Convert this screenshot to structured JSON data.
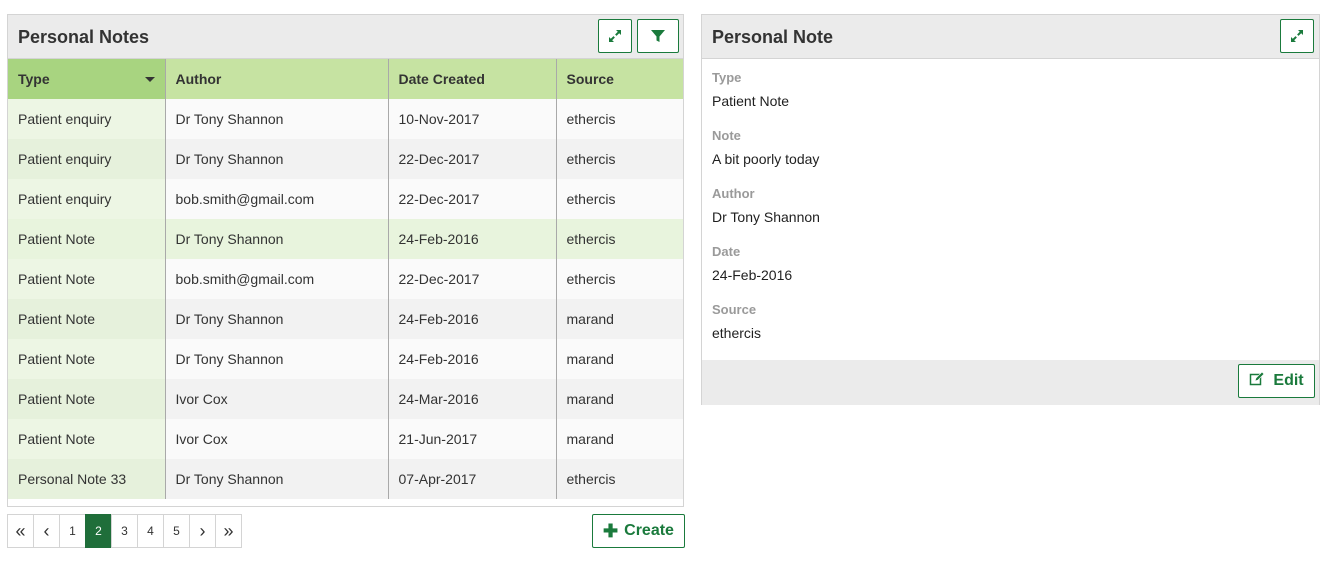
{
  "left_panel": {
    "title": "Personal Notes",
    "expand_icon": "expand-icon",
    "filter_icon": "filter-icon",
    "columns": [
      "Type",
      "Author",
      "Date Created",
      "Source"
    ],
    "sorted_column": "Type",
    "rows": [
      [
        "Patient enquiry",
        "Dr Tony Shannon",
        "10-Nov-2017",
        "ethercis"
      ],
      [
        "Patient enquiry",
        "Dr Tony Shannon",
        "22-Dec-2017",
        "ethercis"
      ],
      [
        "Patient enquiry",
        "bob.smith@gmail.com",
        "22-Dec-2017",
        "ethercis"
      ],
      [
        "Patient Note",
        "Dr Tony Shannon",
        "24-Feb-2016",
        "ethercis"
      ],
      [
        "Patient Note",
        "bob.smith@gmail.com",
        "22-Dec-2017",
        "ethercis"
      ],
      [
        "Patient Note",
        "Dr Tony Shannon",
        "24-Feb-2016",
        "marand"
      ],
      [
        "Patient Note",
        "Dr Tony Shannon",
        "24-Feb-2016",
        "marand"
      ],
      [
        "Patient Note",
        "Ivor Cox",
        "24-Mar-2016",
        "marand"
      ],
      [
        "Patient Note",
        "Ivor Cox",
        "21-Jun-2017",
        "marand"
      ],
      [
        "Personal Note 33",
        "Dr Tony Shannon",
        "07-Apr-2017",
        "ethercis"
      ]
    ],
    "selected_row": 3
  },
  "pagination": {
    "first": "«",
    "prev": "‹",
    "pages": [
      "1",
      "2",
      "3",
      "4",
      "5"
    ],
    "current": "2",
    "next": "›",
    "last": "»"
  },
  "create_button": {
    "label": "Create",
    "icon": "plus-icon"
  },
  "right_panel": {
    "title": "Personal Note",
    "expand_icon": "expand-icon",
    "fields": [
      {
        "label": "Type",
        "value": "Patient Note"
      },
      {
        "label": "Note",
        "value": "A bit poorly today"
      },
      {
        "label": "Author",
        "value": "Dr Tony Shannon"
      },
      {
        "label": "Date",
        "value": "24-Feb-2016"
      },
      {
        "label": "Source",
        "value": "ethercis"
      }
    ],
    "edit_button": {
      "label": "Edit",
      "icon": "edit-icon"
    }
  },
  "colors": {
    "accent": "#1a7a3c",
    "header_green": "#c6e3a2",
    "active_page": "#1f6e3a"
  }
}
